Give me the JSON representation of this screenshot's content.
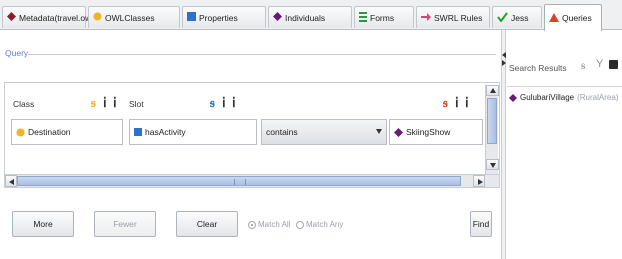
{
  "tabs": [
    {
      "label": "Metadata(travel.owl)",
      "icon": "diamond-icon",
      "color": "#8b1a2b",
      "active": false
    },
    {
      "label": "OWLClasses",
      "icon": "class-circle-icon",
      "color": "#f0b429",
      "active": false
    },
    {
      "label": "Properties",
      "icon": "property-square-icon",
      "color": "#2f6fd0",
      "active": false
    },
    {
      "label": "Individuals",
      "icon": "individual-diamond-icon",
      "color": "#6b1a78",
      "active": false
    },
    {
      "label": "Forms",
      "icon": "forms-icon",
      "color": "#2a9a3a",
      "active": false
    },
    {
      "label": "SWRL Rules",
      "icon": "swrl-arrow-icon",
      "color": "#d9447b",
      "active": false
    },
    {
      "label": "Jess",
      "icon": "check-icon",
      "color": "#2aa02a",
      "active": false
    },
    {
      "label": "Queries",
      "icon": "warning-triangle-icon",
      "color": "#e0402a",
      "active": true
    }
  ],
  "query": {
    "title": "Query",
    "columns": {
      "class_label": "Class",
      "slot_label": "Slot"
    },
    "row": {
      "class_value": "Destination",
      "slot_value": "hasActivity",
      "operator_value": "contains",
      "value": "SkiingShow"
    },
    "buttons": {
      "more": "More",
      "fewer": "Fewer",
      "clear": "Clear",
      "find": "Find"
    },
    "match": {
      "all_label": "Match All",
      "any_label": "Match Any",
      "selected": "all"
    }
  },
  "results": {
    "title": "Search Results",
    "items": [
      {
        "name": "GulubariVillage",
        "type": "(RuralArea)"
      }
    ]
  },
  "colors": {
    "accent_blue": "#2f6fd0",
    "individual_purple": "#6b1a78",
    "class_yellow": "#f0b429",
    "query_title": "#6a7dd6"
  }
}
